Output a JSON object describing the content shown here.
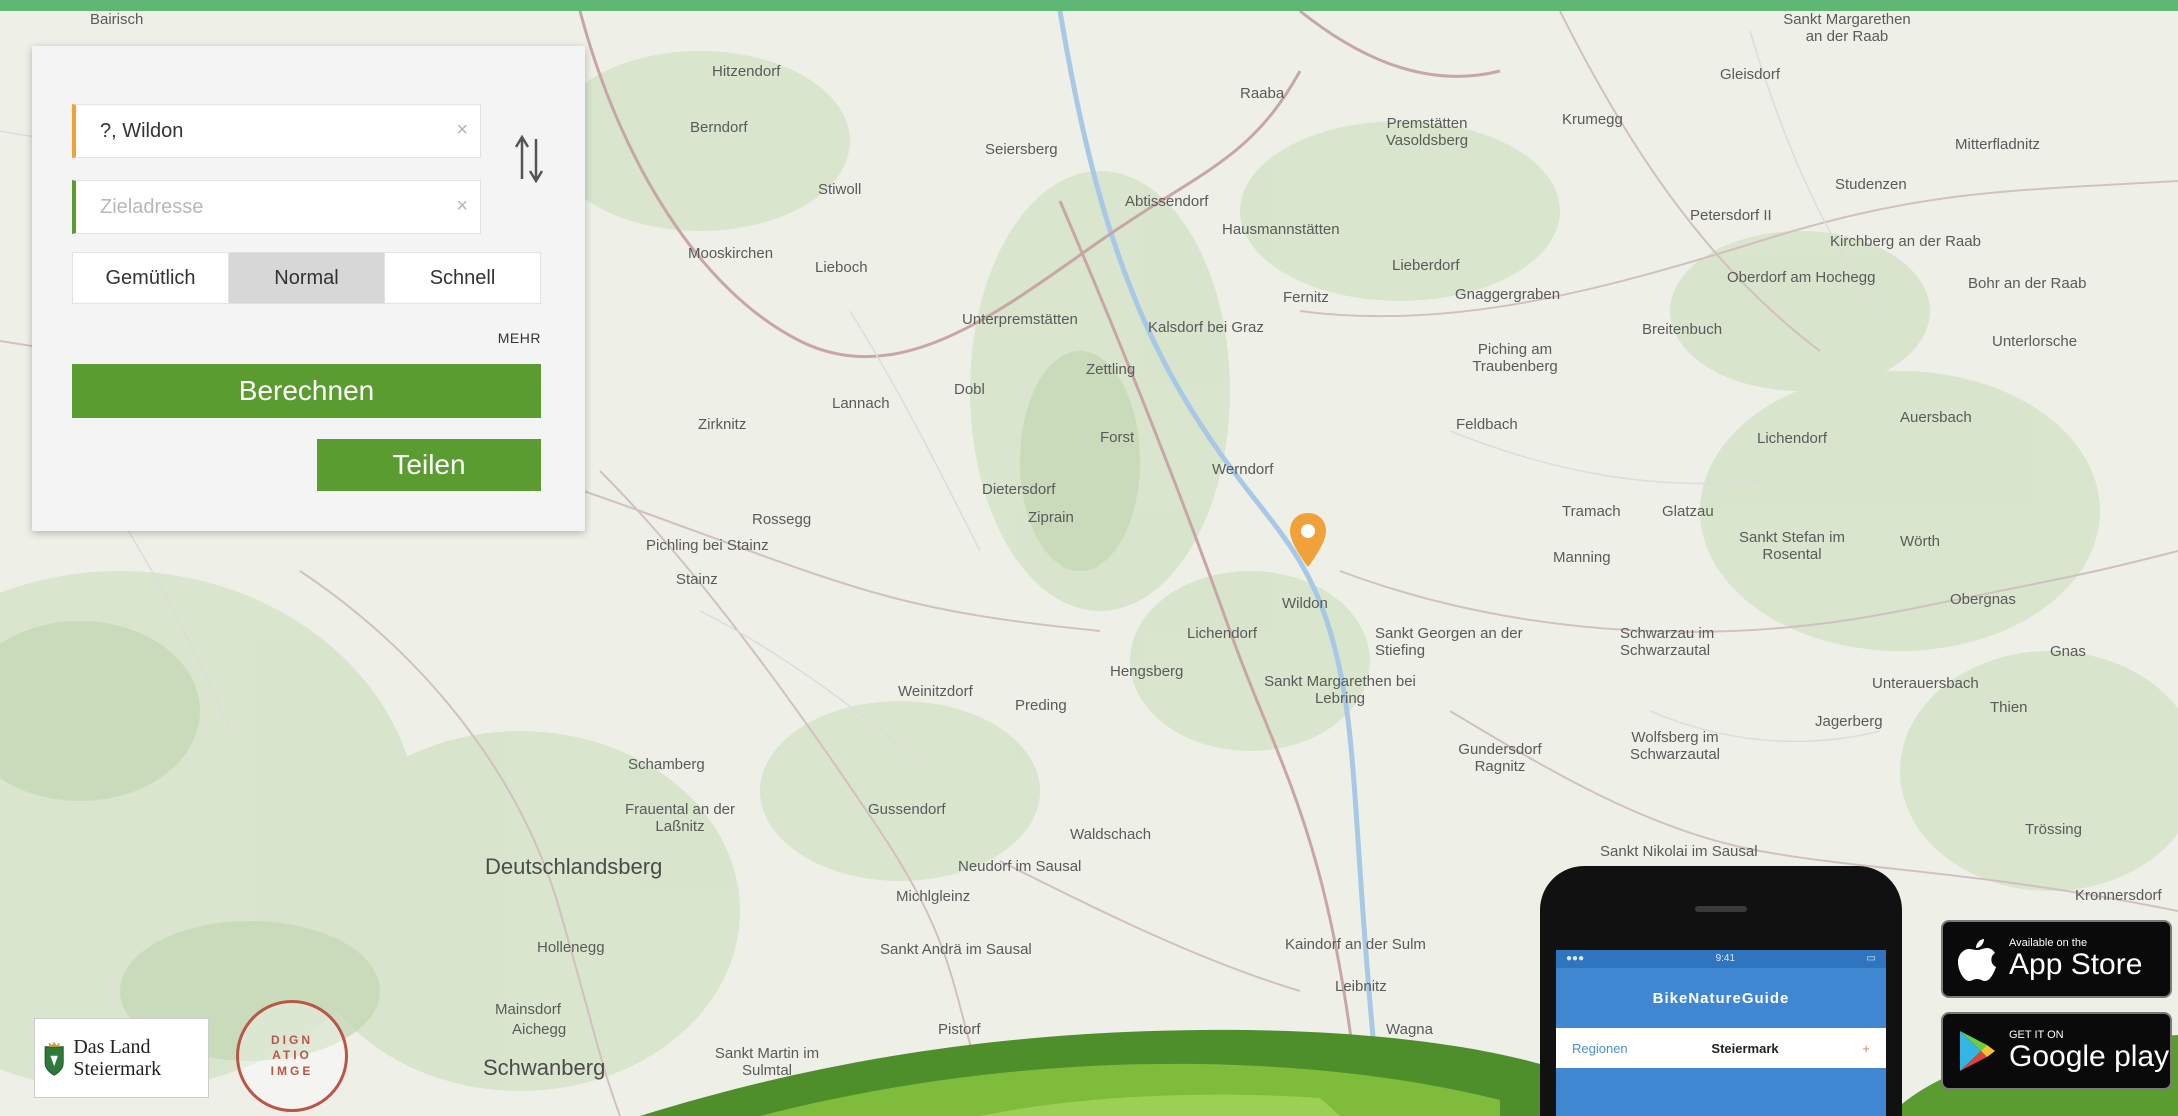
{
  "header": {
    "accent_color": "#5fb775"
  },
  "route_panel": {
    "start_value": "?, Wildon",
    "destination_placeholder": "Zieladresse",
    "clear_icon": "clear-x-icon",
    "swap_icon": "swap-arrows-icon",
    "modes": [
      {
        "label": "Gemütlich",
        "active": false
      },
      {
        "label": "Normal",
        "active": true
      },
      {
        "label": "Schnell",
        "active": false
      }
    ],
    "more_label": "MEHR",
    "calculate_label": "Berechnen",
    "share_label": "Teilen",
    "button_color": "#5a9c30"
  },
  "map": {
    "marker_icon": "location-pin-icon",
    "marker_color": "#f0a13a",
    "places": [
      {
        "name": "Bairisch",
        "big": false
      },
      {
        "name": "Sankt Margarethen an der Raab",
        "big": false
      },
      {
        "name": "Hitzendorf",
        "big": false
      },
      {
        "name": "Raaba",
        "big": false
      },
      {
        "name": "Gleisdorf",
        "big": false
      },
      {
        "name": "Premstätten Vasoldsberg",
        "big": false
      },
      {
        "name": "Krumegg",
        "big": false
      },
      {
        "name": "Mitterfladnitz",
        "big": false
      },
      {
        "name": "Berndorf",
        "big": false
      },
      {
        "name": "Seiersberg",
        "big": false
      },
      {
        "name": "Abtissendorf",
        "big": false
      },
      {
        "name": "Hausmannstätten",
        "big": false
      },
      {
        "name": "Studenzen",
        "big": false
      },
      {
        "name": "Petersdorf II",
        "big": false
      },
      {
        "name": "Kirchberg an der Raab",
        "big": false
      },
      {
        "name": "Stiwoll",
        "big": false
      },
      {
        "name": "Mooskirchen",
        "big": false
      },
      {
        "name": "Lieboch",
        "big": false
      },
      {
        "name": "Unterpremstätten",
        "big": false
      },
      {
        "name": "Kalsdorf bei Graz",
        "big": false
      },
      {
        "name": "Fernitz",
        "big": false
      },
      {
        "name": "Lieberdorf",
        "big": false
      },
      {
        "name": "Gnaggergraben",
        "big": false
      },
      {
        "name": "Breitenbuch",
        "big": false
      },
      {
        "name": "Oberdorf am Hochegg",
        "big": false
      },
      {
        "name": "Bohr an der Raab",
        "big": false
      },
      {
        "name": "Unterlorsche",
        "big": false
      },
      {
        "name": "Zettling",
        "big": false
      },
      {
        "name": "Dobl",
        "big": false
      },
      {
        "name": "Lannach",
        "big": false
      },
      {
        "name": "Zirknitz",
        "big": false
      },
      {
        "name": "Piching am Traubenberg",
        "big": false
      },
      {
        "name": "Feldbach",
        "big": false
      },
      {
        "name": "Lichendorf",
        "big": false
      },
      {
        "name": "Auersbach",
        "big": false
      },
      {
        "name": "Forst",
        "big": false
      },
      {
        "name": "Werndorf",
        "big": false
      },
      {
        "name": "Dietersdorf",
        "big": false
      },
      {
        "name": "Ziprain",
        "big": false
      },
      {
        "name": "Rossegg",
        "big": false
      },
      {
        "name": "Pichling bei Stainz",
        "big": false
      },
      {
        "name": "Stainz",
        "big": false
      },
      {
        "name": "Tramach",
        "big": false
      },
      {
        "name": "Glatzau",
        "big": false
      },
      {
        "name": "Sankt Stefan im Rosental",
        "big": false
      },
      {
        "name": "Wörth",
        "big": false
      },
      {
        "name": "Manning",
        "big": false
      },
      {
        "name": "Obergnas",
        "big": false
      },
      {
        "name": "Wildon",
        "big": false
      },
      {
        "name": "Lichendorf",
        "big": false
      },
      {
        "name": "Sankt Georgen an der Stiefing",
        "big": false
      },
      {
        "name": "Schwarzau im Schwarzautal",
        "big": false
      },
      {
        "name": "Gnas",
        "big": false
      },
      {
        "name": "Hengsberg",
        "big": false
      },
      {
        "name": "Weinitzdorf",
        "big": false
      },
      {
        "name": "Preding",
        "big": false
      },
      {
        "name": "Sankt Margarethen bei Lebring",
        "big": false
      },
      {
        "name": "Unterauersbach",
        "big": false
      },
      {
        "name": "Thien",
        "big": false
      },
      {
        "name": "Frauental an der Laßnitz",
        "big": false
      },
      {
        "name": "Deutschlandsberg",
        "big": true
      },
      {
        "name": "Schamberg",
        "big": false
      },
      {
        "name": "Gundersdorf Ragnitz",
        "big": false
      },
      {
        "name": "Wolfsberg im Schwarzautal",
        "big": false
      },
      {
        "name": "Jagerberg",
        "big": false
      },
      {
        "name": "Gussendorf",
        "big": false
      },
      {
        "name": "Waldschach",
        "big": false
      },
      {
        "name": "Neudorf im Sausal",
        "big": false
      },
      {
        "name": "Michlgleinz",
        "big": false
      },
      {
        "name": "Sankt Nikolai im Sausal",
        "big": false
      },
      {
        "name": "Trössing",
        "big": false
      },
      {
        "name": "Sankt Andrä im Sausal",
        "big": false
      },
      {
        "name": "Kaindorf an der Sulm",
        "big": false
      },
      {
        "name": "Leibnitz",
        "big": false
      },
      {
        "name": "Hollenegg",
        "big": false
      },
      {
        "name": "Mainsdorf",
        "big": false
      },
      {
        "name": "Aichegg",
        "big": false
      },
      {
        "name": "Schwanberg",
        "big": false
      },
      {
        "name": "Sankt Martin im Sulmtal",
        "big": false
      },
      {
        "name": "Pistorf",
        "big": false
      },
      {
        "name": "Wagna",
        "big": false
      },
      {
        "name": "Kronnersdorf",
        "big": false
      }
    ]
  },
  "logos": {
    "land_steiermark": "Das Land Steiermark",
    "stamp_text": [
      "DIGN",
      "ATIO",
      "IMGE"
    ]
  },
  "promo": {
    "app_title": "BikeNatureGuide",
    "tab_left": "Regionen",
    "tab_center": "Steiermark",
    "apple_small": "Available on the",
    "apple_large": "App Store",
    "google_small": "GET IT ON",
    "google_large": "Google play",
    "apple_icon": "apple-logo-icon",
    "google_icon": "google-play-icon"
  }
}
